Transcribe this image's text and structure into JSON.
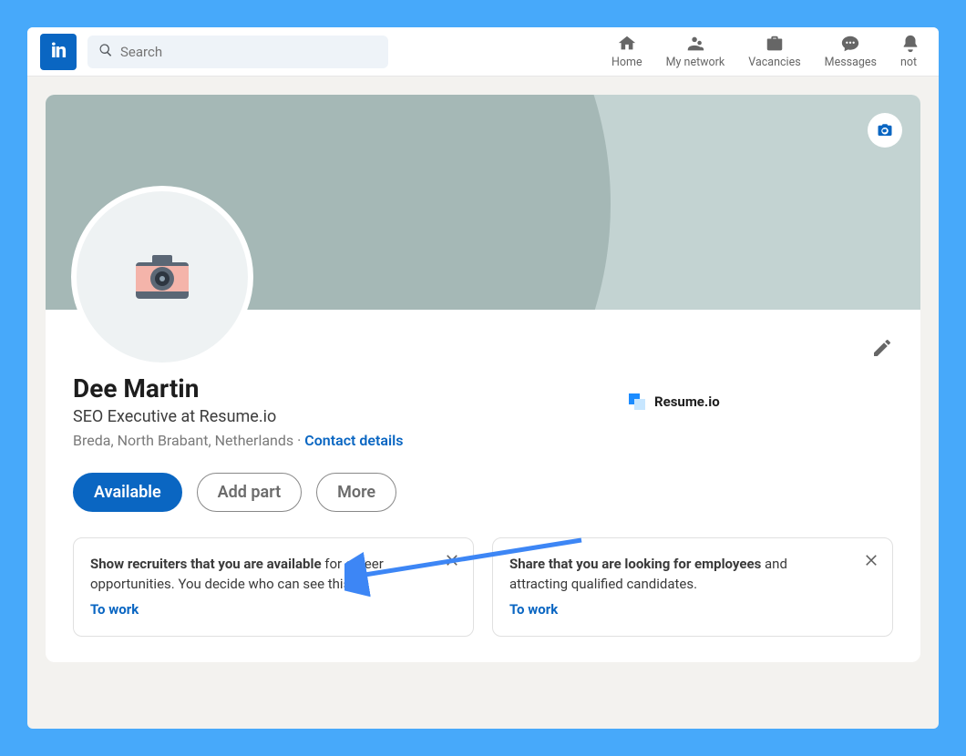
{
  "header": {
    "logo_text": "in",
    "search_placeholder": "Search",
    "nav": {
      "home": "Home",
      "network": "My network",
      "vacancies": "Vacancies",
      "messages": "Messages",
      "notifications_cut": "not"
    }
  },
  "profile": {
    "name": "Dee Martin",
    "headline": "SEO Executive at Resume.io",
    "location": "Breda, North Brabant, Netherlands",
    "location_sep": " · ",
    "contact_link": "Contact details",
    "company_name": "Resume.io",
    "buttons": {
      "available": "Available",
      "add_part": "Add part",
      "more": "More"
    }
  },
  "cards": {
    "recruiters": {
      "bold": "Show recruiters that you are available",
      "rest": " for career opportunities. You decide who can see this.",
      "cta": "To work"
    },
    "employers": {
      "bold": "Share that you are looking for employees",
      "rest": " and attracting qualified candidates.",
      "cta": "To work"
    }
  }
}
